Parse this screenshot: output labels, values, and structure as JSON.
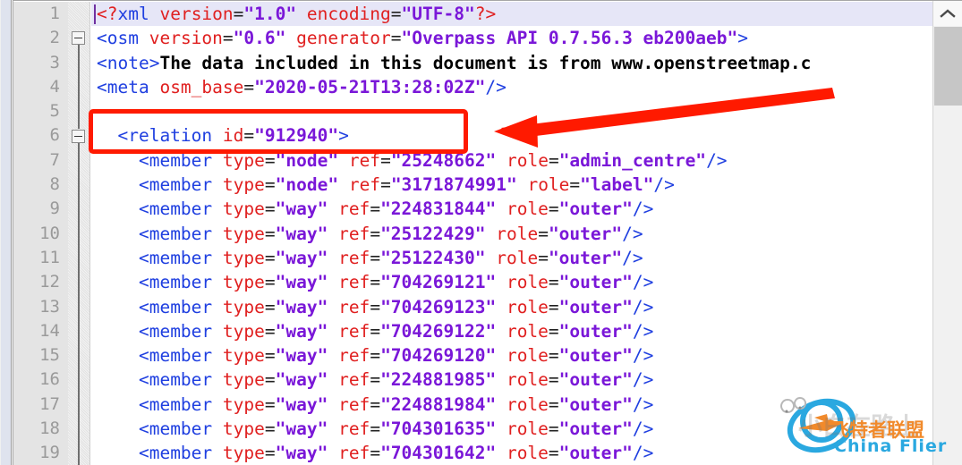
{
  "editor": {
    "type": "xml-code-editor",
    "current_line": 1,
    "first_visible_line": 1,
    "line_numbers": [
      1,
      2,
      3,
      4,
      5,
      6,
      7,
      8,
      9,
      10,
      11,
      12,
      13,
      14,
      15,
      16,
      17,
      18,
      19
    ],
    "fold_markers": [
      {
        "line": 2,
        "state": "expanded",
        "glyph": "minus-box"
      },
      {
        "line": 6,
        "state": "expanded",
        "glyph": "minus-box"
      }
    ],
    "colors": {
      "tag": "#1f3fe0",
      "attribute_name": "#e02020",
      "attribute_value": "#7a17d8",
      "element_text": "#000000",
      "current_line_bg": "#e6e6f7",
      "gutter_bg": "#e4e4e4",
      "line_number": "#9a9a9a",
      "annotation_red": "#ff1a00"
    },
    "lines": [
      {
        "n": 1,
        "tokens": [
          {
            "t": "pi",
            "v": "<?"
          },
          {
            "t": "tg",
            "v": "xml"
          },
          {
            "t": "plain",
            "v": " "
          },
          {
            "t": "at",
            "v": "version"
          },
          {
            "t": "eq",
            "v": "="
          },
          {
            "t": "vl",
            "v": "\"1.0\""
          },
          {
            "t": "plain",
            "v": " "
          },
          {
            "t": "at",
            "v": "encoding"
          },
          {
            "t": "eq",
            "v": "="
          },
          {
            "t": "vl",
            "v": "\"UTF-8\""
          },
          {
            "t": "pi",
            "v": "?>"
          }
        ]
      },
      {
        "n": 2,
        "tokens": [
          {
            "t": "tg",
            "v": "<osm"
          },
          {
            "t": "plain",
            "v": " "
          },
          {
            "t": "at",
            "v": "version"
          },
          {
            "t": "eq",
            "v": "="
          },
          {
            "t": "vl",
            "v": "\"0.6\""
          },
          {
            "t": "plain",
            "v": " "
          },
          {
            "t": "at",
            "v": "generator"
          },
          {
            "t": "eq",
            "v": "="
          },
          {
            "t": "vl",
            "v": "\"Overpass API 0.7.56.3 eb200aeb\""
          },
          {
            "t": "tg",
            "v": ">"
          }
        ]
      },
      {
        "n": 3,
        "tokens": [
          {
            "t": "tg",
            "v": "<note>"
          },
          {
            "t": "tx",
            "v": "The data included in this document is from www.openstreetmap.c"
          }
        ]
      },
      {
        "n": 4,
        "tokens": [
          {
            "t": "tg",
            "v": "<meta"
          },
          {
            "t": "plain",
            "v": " "
          },
          {
            "t": "at",
            "v": "osm_base"
          },
          {
            "t": "eq",
            "v": "="
          },
          {
            "t": "vl",
            "v": "\"2020-05-21T13:28:02Z\""
          },
          {
            "t": "tg",
            "v": "/>"
          }
        ]
      },
      {
        "n": 5,
        "tokens": []
      },
      {
        "n": 6,
        "tokens": [
          {
            "t": "plain",
            "v": "  "
          },
          {
            "t": "tg",
            "v": "<relation"
          },
          {
            "t": "plain",
            "v": " "
          },
          {
            "t": "at",
            "v": "id"
          },
          {
            "t": "eq",
            "v": "="
          },
          {
            "t": "vl",
            "v": "\"912940\""
          },
          {
            "t": "tg",
            "v": ">"
          }
        ]
      },
      {
        "n": 7,
        "tokens": [
          {
            "t": "plain",
            "v": "    "
          },
          {
            "t": "tg",
            "v": "<member"
          },
          {
            "t": "plain",
            "v": " "
          },
          {
            "t": "at",
            "v": "type"
          },
          {
            "t": "eq",
            "v": "="
          },
          {
            "t": "vl",
            "v": "\"node\""
          },
          {
            "t": "plain",
            "v": " "
          },
          {
            "t": "at",
            "v": "ref"
          },
          {
            "t": "eq",
            "v": "="
          },
          {
            "t": "vl",
            "v": "\"25248662\""
          },
          {
            "t": "plain",
            "v": " "
          },
          {
            "t": "at",
            "v": "role"
          },
          {
            "t": "eq",
            "v": "="
          },
          {
            "t": "vl",
            "v": "\"admin_centre\""
          },
          {
            "t": "tg",
            "v": "/>"
          }
        ]
      },
      {
        "n": 8,
        "tokens": [
          {
            "t": "plain",
            "v": "    "
          },
          {
            "t": "tg",
            "v": "<member"
          },
          {
            "t": "plain",
            "v": " "
          },
          {
            "t": "at",
            "v": "type"
          },
          {
            "t": "eq",
            "v": "="
          },
          {
            "t": "vl",
            "v": "\"node\""
          },
          {
            "t": "plain",
            "v": " "
          },
          {
            "t": "at",
            "v": "ref"
          },
          {
            "t": "eq",
            "v": "="
          },
          {
            "t": "vl",
            "v": "\"3171874991\""
          },
          {
            "t": "plain",
            "v": " "
          },
          {
            "t": "at",
            "v": "role"
          },
          {
            "t": "eq",
            "v": "="
          },
          {
            "t": "vl",
            "v": "\"label\""
          },
          {
            "t": "tg",
            "v": "/>"
          }
        ]
      },
      {
        "n": 9,
        "tokens": [
          {
            "t": "plain",
            "v": "    "
          },
          {
            "t": "tg",
            "v": "<member"
          },
          {
            "t": "plain",
            "v": " "
          },
          {
            "t": "at",
            "v": "type"
          },
          {
            "t": "eq",
            "v": "="
          },
          {
            "t": "vl",
            "v": "\"way\""
          },
          {
            "t": "plain",
            "v": " "
          },
          {
            "t": "at",
            "v": "ref"
          },
          {
            "t": "eq",
            "v": "="
          },
          {
            "t": "vl",
            "v": "\"224831844\""
          },
          {
            "t": "plain",
            "v": " "
          },
          {
            "t": "at",
            "v": "role"
          },
          {
            "t": "eq",
            "v": "="
          },
          {
            "t": "vl",
            "v": "\"outer\""
          },
          {
            "t": "tg",
            "v": "/>"
          }
        ]
      },
      {
        "n": 10,
        "tokens": [
          {
            "t": "plain",
            "v": "    "
          },
          {
            "t": "tg",
            "v": "<member"
          },
          {
            "t": "plain",
            "v": " "
          },
          {
            "t": "at",
            "v": "type"
          },
          {
            "t": "eq",
            "v": "="
          },
          {
            "t": "vl",
            "v": "\"way\""
          },
          {
            "t": "plain",
            "v": " "
          },
          {
            "t": "at",
            "v": "ref"
          },
          {
            "t": "eq",
            "v": "="
          },
          {
            "t": "vl",
            "v": "\"25122429\""
          },
          {
            "t": "plain",
            "v": " "
          },
          {
            "t": "at",
            "v": "role"
          },
          {
            "t": "eq",
            "v": "="
          },
          {
            "t": "vl",
            "v": "\"outer\""
          },
          {
            "t": "tg",
            "v": "/>"
          }
        ]
      },
      {
        "n": 11,
        "tokens": [
          {
            "t": "plain",
            "v": "    "
          },
          {
            "t": "tg",
            "v": "<member"
          },
          {
            "t": "plain",
            "v": " "
          },
          {
            "t": "at",
            "v": "type"
          },
          {
            "t": "eq",
            "v": "="
          },
          {
            "t": "vl",
            "v": "\"way\""
          },
          {
            "t": "plain",
            "v": " "
          },
          {
            "t": "at",
            "v": "ref"
          },
          {
            "t": "eq",
            "v": "="
          },
          {
            "t": "vl",
            "v": "\"25122430\""
          },
          {
            "t": "plain",
            "v": " "
          },
          {
            "t": "at",
            "v": "role"
          },
          {
            "t": "eq",
            "v": "="
          },
          {
            "t": "vl",
            "v": "\"outer\""
          },
          {
            "t": "tg",
            "v": "/>"
          }
        ]
      },
      {
        "n": 12,
        "tokens": [
          {
            "t": "plain",
            "v": "    "
          },
          {
            "t": "tg",
            "v": "<member"
          },
          {
            "t": "plain",
            "v": " "
          },
          {
            "t": "at",
            "v": "type"
          },
          {
            "t": "eq",
            "v": "="
          },
          {
            "t": "vl",
            "v": "\"way\""
          },
          {
            "t": "plain",
            "v": " "
          },
          {
            "t": "at",
            "v": "ref"
          },
          {
            "t": "eq",
            "v": "="
          },
          {
            "t": "vl",
            "v": "\"704269121\""
          },
          {
            "t": "plain",
            "v": " "
          },
          {
            "t": "at",
            "v": "role"
          },
          {
            "t": "eq",
            "v": "="
          },
          {
            "t": "vl",
            "v": "\"outer\""
          },
          {
            "t": "tg",
            "v": "/>"
          }
        ]
      },
      {
        "n": 13,
        "tokens": [
          {
            "t": "plain",
            "v": "    "
          },
          {
            "t": "tg",
            "v": "<member"
          },
          {
            "t": "plain",
            "v": " "
          },
          {
            "t": "at",
            "v": "type"
          },
          {
            "t": "eq",
            "v": "="
          },
          {
            "t": "vl",
            "v": "\"way\""
          },
          {
            "t": "plain",
            "v": " "
          },
          {
            "t": "at",
            "v": "ref"
          },
          {
            "t": "eq",
            "v": "="
          },
          {
            "t": "vl",
            "v": "\"704269123\""
          },
          {
            "t": "plain",
            "v": " "
          },
          {
            "t": "at",
            "v": "role"
          },
          {
            "t": "eq",
            "v": "="
          },
          {
            "t": "vl",
            "v": "\"outer\""
          },
          {
            "t": "tg",
            "v": "/>"
          }
        ]
      },
      {
        "n": 14,
        "tokens": [
          {
            "t": "plain",
            "v": "    "
          },
          {
            "t": "tg",
            "v": "<member"
          },
          {
            "t": "plain",
            "v": " "
          },
          {
            "t": "at",
            "v": "type"
          },
          {
            "t": "eq",
            "v": "="
          },
          {
            "t": "vl",
            "v": "\"way\""
          },
          {
            "t": "plain",
            "v": " "
          },
          {
            "t": "at",
            "v": "ref"
          },
          {
            "t": "eq",
            "v": "="
          },
          {
            "t": "vl",
            "v": "\"704269122\""
          },
          {
            "t": "plain",
            "v": " "
          },
          {
            "t": "at",
            "v": "role"
          },
          {
            "t": "eq",
            "v": "="
          },
          {
            "t": "vl",
            "v": "\"outer\""
          },
          {
            "t": "tg",
            "v": "/>"
          }
        ]
      },
      {
        "n": 15,
        "tokens": [
          {
            "t": "plain",
            "v": "    "
          },
          {
            "t": "tg",
            "v": "<member"
          },
          {
            "t": "plain",
            "v": " "
          },
          {
            "t": "at",
            "v": "type"
          },
          {
            "t": "eq",
            "v": "="
          },
          {
            "t": "vl",
            "v": "\"way\""
          },
          {
            "t": "plain",
            "v": " "
          },
          {
            "t": "at",
            "v": "ref"
          },
          {
            "t": "eq",
            "v": "="
          },
          {
            "t": "vl",
            "v": "\"704269120\""
          },
          {
            "t": "plain",
            "v": " "
          },
          {
            "t": "at",
            "v": "role"
          },
          {
            "t": "eq",
            "v": "="
          },
          {
            "t": "vl",
            "v": "\"outer\""
          },
          {
            "t": "tg",
            "v": "/>"
          }
        ]
      },
      {
        "n": 16,
        "tokens": [
          {
            "t": "plain",
            "v": "    "
          },
          {
            "t": "tg",
            "v": "<member"
          },
          {
            "t": "plain",
            "v": " "
          },
          {
            "t": "at",
            "v": "type"
          },
          {
            "t": "eq",
            "v": "="
          },
          {
            "t": "vl",
            "v": "\"way\""
          },
          {
            "t": "plain",
            "v": " "
          },
          {
            "t": "at",
            "v": "ref"
          },
          {
            "t": "eq",
            "v": "="
          },
          {
            "t": "vl",
            "v": "\"224881985\""
          },
          {
            "t": "plain",
            "v": " "
          },
          {
            "t": "at",
            "v": "role"
          },
          {
            "t": "eq",
            "v": "="
          },
          {
            "t": "vl",
            "v": "\"outer\""
          },
          {
            "t": "tg",
            "v": "/>"
          }
        ]
      },
      {
        "n": 17,
        "tokens": [
          {
            "t": "plain",
            "v": "    "
          },
          {
            "t": "tg",
            "v": "<member"
          },
          {
            "t": "plain",
            "v": " "
          },
          {
            "t": "at",
            "v": "type"
          },
          {
            "t": "eq",
            "v": "="
          },
          {
            "t": "vl",
            "v": "\"way\""
          },
          {
            "t": "plain",
            "v": " "
          },
          {
            "t": "at",
            "v": "ref"
          },
          {
            "t": "eq",
            "v": "="
          },
          {
            "t": "vl",
            "v": "\"224881984\""
          },
          {
            "t": "plain",
            "v": " "
          },
          {
            "t": "at",
            "v": "role"
          },
          {
            "t": "eq",
            "v": "="
          },
          {
            "t": "vl",
            "v": "\"outer\""
          },
          {
            "t": "tg",
            "v": "/>"
          }
        ]
      },
      {
        "n": 18,
        "tokens": [
          {
            "t": "plain",
            "v": "    "
          },
          {
            "t": "tg",
            "v": "<member"
          },
          {
            "t": "plain",
            "v": " "
          },
          {
            "t": "at",
            "v": "type"
          },
          {
            "t": "eq",
            "v": "="
          },
          {
            "t": "vl",
            "v": "\"way\""
          },
          {
            "t": "plain",
            "v": " "
          },
          {
            "t": "at",
            "v": "ref"
          },
          {
            "t": "eq",
            "v": "="
          },
          {
            "t": "vl",
            "v": "\"704301635\""
          },
          {
            "t": "plain",
            "v": " "
          },
          {
            "t": "at",
            "v": "role"
          },
          {
            "t": "eq",
            "v": "="
          },
          {
            "t": "vl",
            "v": "\"outer\""
          },
          {
            "t": "tg",
            "v": "/>"
          }
        ]
      },
      {
        "n": 19,
        "tokens": [
          {
            "t": "plain",
            "v": "    "
          },
          {
            "t": "tg",
            "v": "<member"
          },
          {
            "t": "plain",
            "v": " "
          },
          {
            "t": "at",
            "v": "type"
          },
          {
            "t": "eq",
            "v": "="
          },
          {
            "t": "vl",
            "v": "\"way\""
          },
          {
            "t": "plain",
            "v": " "
          },
          {
            "t": "at",
            "v": "ref"
          },
          {
            "t": "eq",
            "v": "="
          },
          {
            "t": "vl",
            "v": "\"704301642\""
          },
          {
            "t": "plain",
            "v": " "
          },
          {
            "t": "at",
            "v": "role"
          },
          {
            "t": "eq",
            "v": "="
          },
          {
            "t": "vl",
            "v": "\"outer\""
          },
          {
            "t": "tg",
            "v": "/>"
          }
        ]
      }
    ]
  },
  "annotations": {
    "highlight_box": {
      "target_line": 6,
      "target_text": "<relation id=\"912940\">",
      "color": "#ff1a00",
      "shape": "rounded-rectangle"
    },
    "arrow": {
      "color": "#ff1a00",
      "direction": "left",
      "points_to": "highlight-box"
    }
  },
  "scrollbar": {
    "orientation": "vertical",
    "up_arrow": "chevron-up-icon",
    "thumb_position_percent": 6
  },
  "watermark": {
    "cn_text": "飞特者联盟",
    "en_text": "China Flier",
    "ghost_text": "小白在路上",
    "cn_color": "#f18a2b",
    "en_color": "#2aa8e0"
  }
}
